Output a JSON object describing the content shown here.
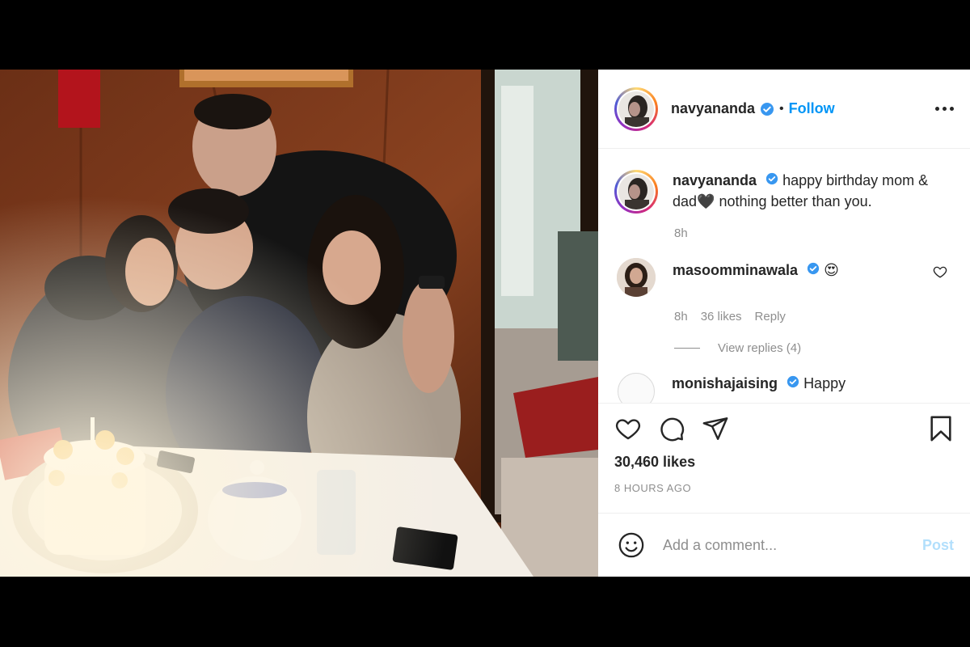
{
  "post": {
    "username": "navyananda",
    "follow_label": "Follow",
    "separator": "•",
    "caption": "happy birthday mom & dad🖤 nothing better than you.",
    "caption_time": "8h"
  },
  "comments": [
    {
      "username": "masoomminawala",
      "text": "😍",
      "time": "8h",
      "likes": "36 likes",
      "reply_label": "Reply",
      "view_replies": "View replies (4)"
    },
    {
      "username": "monishajaising",
      "text": "Happy"
    }
  ],
  "actions": {
    "likes": "30,460 likes",
    "timestamp": "8 HOURS AGO"
  },
  "add_comment": {
    "placeholder": "Add a comment...",
    "post_label": "Post"
  },
  "colors": {
    "accent": "#0095f6",
    "post_disabled": "#b2dffc",
    "secondary_text": "#8e8e8e",
    "primary_text": "#262626"
  },
  "icons": [
    "verified-badge-icon",
    "more-options-icon",
    "heart-icon",
    "comment-icon",
    "share-icon",
    "bookmark-icon",
    "emoji-icon"
  ]
}
